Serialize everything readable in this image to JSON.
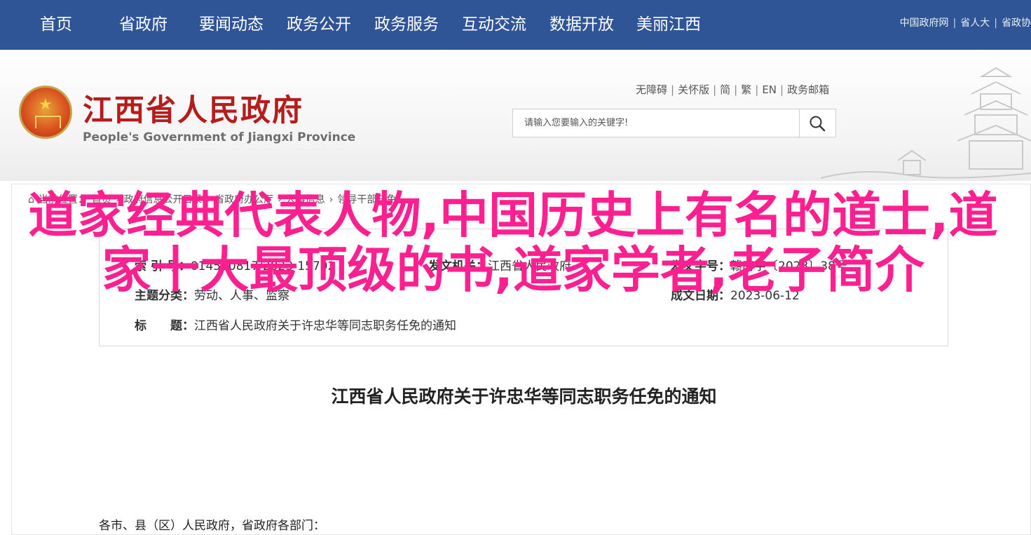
{
  "topnav": {
    "items": [
      "首页",
      "省政府",
      "要闻动态",
      "政务公开",
      "政务服务",
      "互动交流",
      "数据开放",
      "美丽江西"
    ],
    "links": [
      "中国政府网",
      "省人大",
      "省政协"
    ]
  },
  "header": {
    "title": "江西省人民政府",
    "subtitle": "People's Government of Jiangxi Province",
    "util_links": [
      "无障碍",
      "关怀版",
      "简",
      "繁",
      "EN",
      "政务邮箱"
    ],
    "search_placeholder": "请输入您要输入的关键字!"
  },
  "breadcrumb": {
    "prefix": "当前位置：",
    "items": [
      "首页",
      "政府信息公开目录",
      "省政府办公厅",
      "人事信息",
      "领导干部任免"
    ]
  },
  "info": {
    "index_label": "索 引 号：",
    "index_value": "014500817/2023-15792",
    "org_label": "发文机关：",
    "org_value": "江西省人民政府",
    "doc_no_label": "发文字号：",
    "doc_no_value": "赣府字〔2023〕38号",
    "category_label": "主题分类：",
    "category_value": "劳动、人事、监察",
    "date_label": "成文日期：",
    "date_value": "2023-06-12",
    "subject_label": "标　　题：",
    "subject_value": "江西省人民政府关于许忠华等同志职务任免的通知"
  },
  "document": {
    "title": "江西省人民政府关于许忠华等同志职务任免的通知",
    "salutation": "各市、县（区）人民政府，省政府各部门："
  },
  "overlay": {
    "headline": "道家经典代表人物,中国历史上有名的道士,道家十大最顶级的书,道家学者,老子简介",
    "color": "#ff1f8e"
  },
  "colors": {
    "nav_bg": "#2f5596",
    "title_red": "#b71c1c"
  }
}
